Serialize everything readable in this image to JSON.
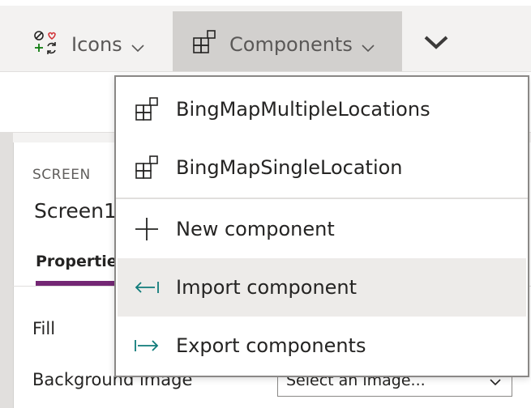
{
  "ribbon": {
    "icons_label": "Icons",
    "components_label": "Components"
  },
  "panel": {
    "screen_caption": "SCREEN",
    "screen_name": "Screen1",
    "tab_properties": "Properties",
    "fill_label": "Fill",
    "background_image_label": "Background image",
    "background_image_placeholder": "Select an image..."
  },
  "menu": {
    "items": [
      {
        "label": "BingMapMultipleLocations",
        "icon": "component-icon"
      },
      {
        "label": "BingMapSingleLocation",
        "icon": "component-icon"
      },
      {
        "label": "New component",
        "icon": "plus-icon"
      },
      {
        "label": "Import component",
        "icon": "import-icon"
      },
      {
        "label": "Export components",
        "icon": "export-icon"
      }
    ],
    "hovered_item": "Import component"
  },
  "colors": {
    "accent_purple": "#742774",
    "teal_icon": "#0f7b7a",
    "ribbon_selected": "#d2d0ce",
    "hover_bg": "#edebe9"
  }
}
